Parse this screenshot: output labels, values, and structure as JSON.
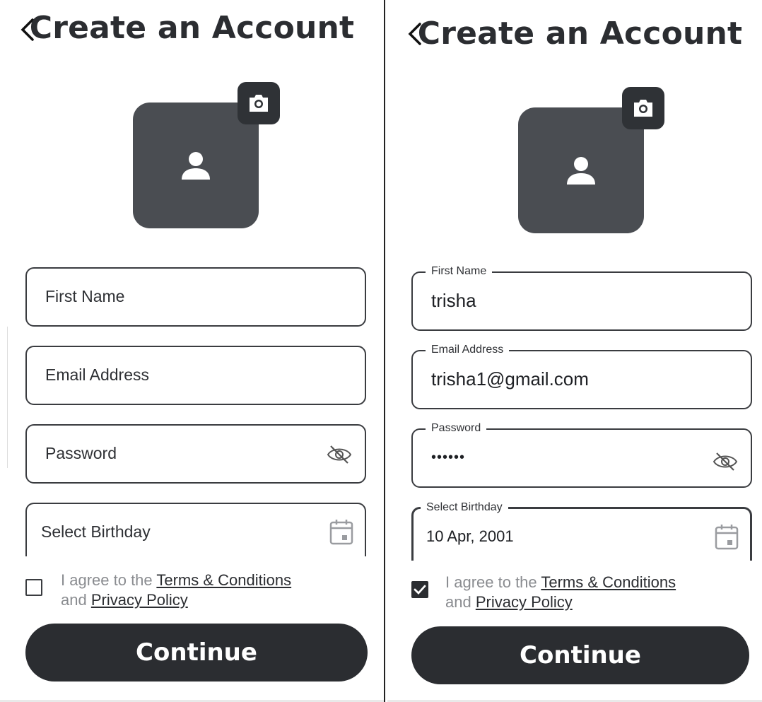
{
  "left": {
    "back_icon": "chevron-left",
    "title": "Create an Account",
    "camera_icon": "camera",
    "avatar_icon": "person",
    "fields": {
      "first_name": {
        "placeholder": "First Name"
      },
      "email": {
        "placeholder": "Email Address"
      },
      "password": {
        "placeholder": "Password",
        "icon": "eye-off"
      },
      "birthday": {
        "placeholder": "Select Birthday",
        "icon": "calendar"
      }
    },
    "agree": {
      "checked": false,
      "prefix": "I agree to the ",
      "terms": "Terms & Conditions",
      "middle": "and ",
      "privacy": "Privacy Policy "
    },
    "continue_label": "Continue"
  },
  "right": {
    "back_icon": "chevron-left",
    "title": "Create an Account",
    "camera_icon": "camera",
    "avatar_icon": "person",
    "fields": {
      "first_name": {
        "label": "First Name",
        "value": "trisha"
      },
      "email": {
        "label": "Email Address",
        "value": "trisha1@gmail.com"
      },
      "password": {
        "label": "Password",
        "value": "••••••",
        "icon": "eye-off"
      },
      "birthday": {
        "label": "Select Birthday",
        "value": "10 Apr, 2001",
        "icon": "calendar"
      }
    },
    "agree": {
      "checked": true,
      "prefix": "I agree to the ",
      "terms": "Terms & Conditions",
      "middle": "and ",
      "privacy": "Privacy Policy "
    },
    "continue_label": "Continue"
  },
  "colors": {
    "primary": "#2b2d31",
    "avatar_bg": "#4a4d52",
    "muted_text": "#8a8c90"
  }
}
